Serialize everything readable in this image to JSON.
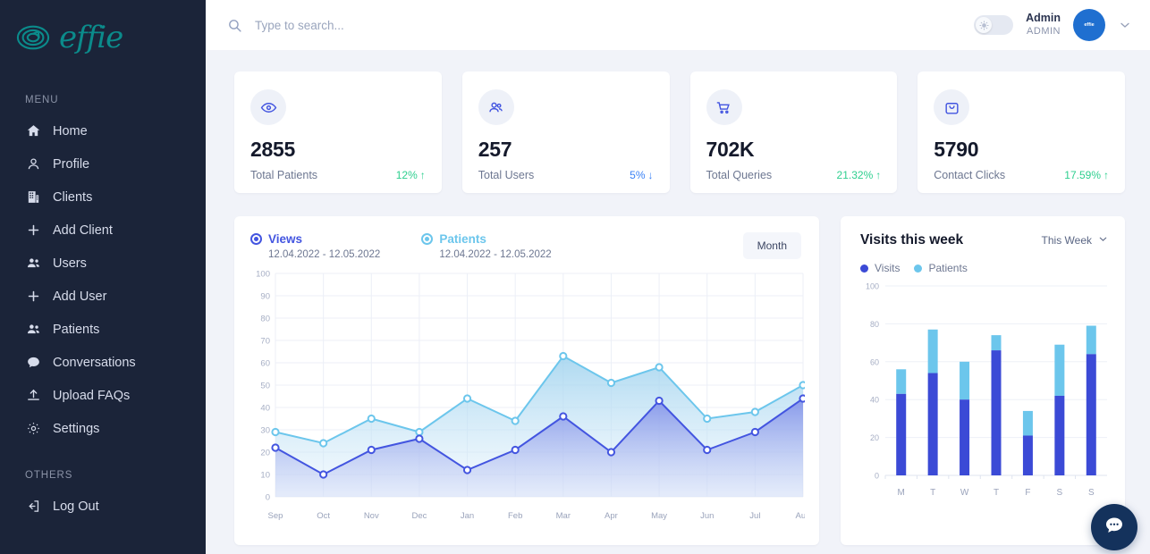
{
  "sidebar": {
    "brand": {
      "word": "effie",
      "logo_icon": "effie-spiral-logo"
    },
    "menu_label": "MENU",
    "others_label": "OTHERS",
    "items": [
      {
        "label": "Home",
        "icon": "home-icon"
      },
      {
        "label": "Profile",
        "icon": "user-icon"
      },
      {
        "label": "Clients",
        "icon": "building-icon"
      },
      {
        "label": "Add Client",
        "icon": "plus-icon"
      },
      {
        "label": "Users",
        "icon": "users-icon"
      },
      {
        "label": "Add User",
        "icon": "plus-icon"
      },
      {
        "label": "Patients",
        "icon": "users-icon"
      },
      {
        "label": "Conversations",
        "icon": "chat-bubble-icon"
      },
      {
        "label": "Upload FAQs",
        "icon": "upload-icon"
      },
      {
        "label": "Settings",
        "icon": "gear-icon"
      }
    ],
    "others": [
      {
        "label": "Log Out",
        "icon": "logout-icon"
      }
    ]
  },
  "header": {
    "search": {
      "placeholder": "Type to search...",
      "value": "",
      "icon": "search-icon"
    },
    "theme_toggle": {
      "icon": "sun-icon",
      "state": "light"
    },
    "user": {
      "name": "Admin",
      "role": "ADMIN",
      "avatar_text": "effie"
    },
    "chevron_icon": "chevron-down-icon"
  },
  "stats": [
    {
      "value": "2855",
      "label": "Total Patients",
      "delta": "12%",
      "direction": "up",
      "icon": "eye-icon",
      "delta_color": "#2ecf8f"
    },
    {
      "value": "257",
      "label": "Total Users",
      "delta": "5%",
      "direction": "down",
      "icon": "users-icon",
      "delta_color": "#3b82f6"
    },
    {
      "value": "702K",
      "label": "Total Queries",
      "delta": "21.32%",
      "direction": "up",
      "icon": "cart-icon",
      "delta_color": "#2ecf8f"
    },
    {
      "value": "5790",
      "label": "Contact Clicks",
      "delta": "17.59%",
      "direction": "up",
      "icon": "bag-icon",
      "delta_color": "#2ecf8f"
    }
  ],
  "area_panel": {
    "series": [
      {
        "name": "Views",
        "range": "12.04.2022 - 12.05.2022",
        "color": "#4355e0",
        "selected": true
      },
      {
        "name": "Patients",
        "range": "12.04.2022 - 12.05.2022",
        "color": "#6cc6ec",
        "selected": true
      }
    ],
    "period_button": "Month"
  },
  "visits_panel": {
    "title": "Visits this week",
    "period": "This Week",
    "chevron_icon": "chevron-down-icon",
    "legend": [
      {
        "label": "Visits",
        "color": "#3b4ad6"
      },
      {
        "label": "Patients",
        "color": "#6cc6ec"
      }
    ]
  },
  "fab": {
    "icon": "chat-bubble-icon"
  },
  "chart_data": [
    {
      "type": "area",
      "title": "",
      "xlabel": "",
      "ylabel": "",
      "categories": [
        "Sep",
        "Oct",
        "Nov",
        "Dec",
        "Jan",
        "Feb",
        "Mar",
        "Apr",
        "May",
        "Jun",
        "Jul",
        "Aug"
      ],
      "ylim": [
        0,
        100
      ],
      "yticks": [
        0,
        10,
        20,
        30,
        40,
        50,
        60,
        70,
        80,
        90,
        100
      ],
      "grid": true,
      "legend_position": "top-left",
      "series": [
        {
          "name": "Patients",
          "color": "#6cc6ec",
          "values": [
            29,
            24,
            35,
            29,
            44,
            34,
            63,
            51,
            58,
            35,
            38,
            50
          ]
        },
        {
          "name": "Views",
          "color": "#4355e0",
          "values": [
            22,
            10,
            21,
            26,
            12,
            21,
            36,
            20,
            43,
            21,
            29,
            44
          ]
        }
      ]
    },
    {
      "type": "bar",
      "title": "Visits this week",
      "xlabel": "",
      "ylabel": "",
      "categories": [
        "M",
        "T",
        "W",
        "T",
        "F",
        "S",
        "S"
      ],
      "ylim": [
        0,
        100
      ],
      "yticks": [
        0,
        20,
        40,
        60,
        80,
        100
      ],
      "grid": true,
      "stacked": true,
      "legend_position": "top-left",
      "series": [
        {
          "name": "Visits",
          "color": "#3b4ad6",
          "values": [
            43,
            54,
            40,
            66,
            21,
            42,
            64
          ]
        },
        {
          "name": "Patients",
          "color": "#6cc6ec",
          "values": [
            13,
            23,
            20,
            8,
            13,
            27,
            15
          ]
        }
      ],
      "totals": [
        56,
        77,
        60,
        74,
        34,
        69,
        79
      ]
    }
  ]
}
